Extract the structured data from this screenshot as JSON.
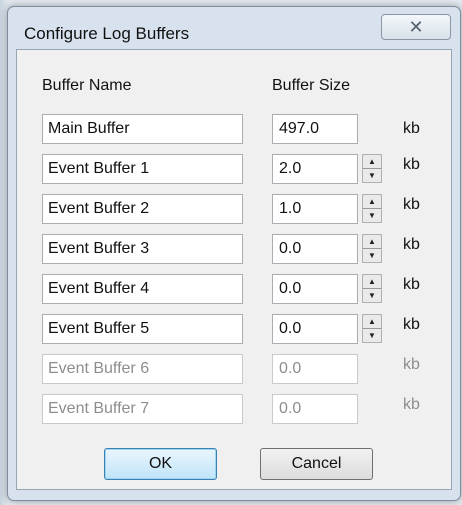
{
  "dialog": {
    "title": "Configure Log  Buffers",
    "close_glyph": "✕"
  },
  "headers": {
    "name": "Buffer Name",
    "size": "Buffer Size"
  },
  "unit": "kb",
  "rows": [
    {
      "name": "Main Buffer",
      "size": "497.0",
      "enabled": true,
      "spinner": false
    },
    {
      "name": "Event Buffer 1",
      "size": "2.0",
      "enabled": true,
      "spinner": true
    },
    {
      "name": "Event Buffer 2",
      "size": "1.0",
      "enabled": true,
      "spinner": true
    },
    {
      "name": "Event Buffer 3",
      "size": "0.0",
      "enabled": true,
      "spinner": true
    },
    {
      "name": "Event Buffer 4",
      "size": "0.0",
      "enabled": true,
      "spinner": true
    },
    {
      "name": "Event Buffer 5",
      "size": "0.0",
      "enabled": true,
      "spinner": true
    },
    {
      "name": "Event Buffer 6",
      "size": "0.0",
      "enabled": false,
      "spinner": false
    },
    {
      "name": "Event Buffer 7",
      "size": "0.0",
      "enabled": false,
      "spinner": false
    }
  ],
  "buttons": {
    "ok": "OK",
    "cancel": "Cancel"
  }
}
